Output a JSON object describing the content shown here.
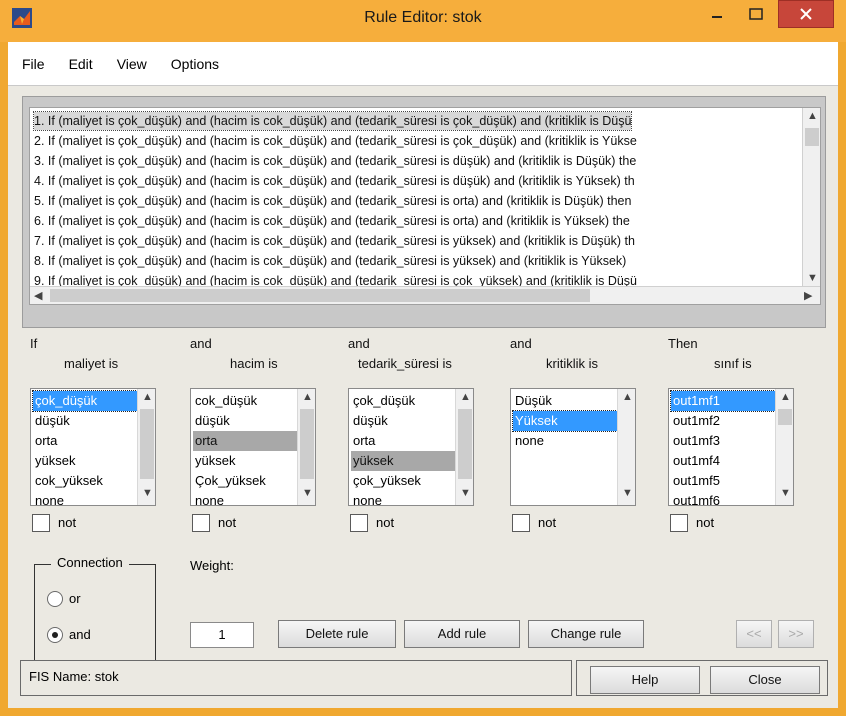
{
  "window": {
    "title": "Rule Editor: stok"
  },
  "menu": [
    "File",
    "Edit",
    "View",
    "Options"
  ],
  "rules": [
    "1. If (maliyet is çok_düşük) and (hacim is cok_düşük) and (tedarik_süresi is çok_düşük) and (kritiklik is Düşü",
    "2. If (maliyet is çok_düşük) and (hacim is cok_düşük) and (tedarik_süresi is çok_düşük) and (kritiklik is Yükse",
    "3. If (maliyet is çok_düşük) and (hacim is cok_düşük) and (tedarik_süresi is düşük) and (kritiklik is Düşük) the",
    "4. If (maliyet is çok_düşük) and (hacim is cok_düşük) and (tedarik_süresi is düşük) and (kritiklik is Yüksek) th",
    "5. If (maliyet is çok_düşük) and (hacim is cok_düşük) and (tedarik_süresi is orta) and (kritiklik is Düşük) then",
    "6. If (maliyet is çok_düşük) and (hacim is cok_düşük) and (tedarik_süresi is orta) and (kritiklik is Yüksek) the",
    "7. If (maliyet is çok_düşük) and (hacim is cok_düşük) and (tedarik_süresi is yüksek) and (kritiklik is Düşük) th",
    "8. If (maliyet is çok_düşük) and (hacim is cok_düşük) and (tedarik_süresi is yüksek) and (kritiklik is Yüksek)",
    "9. If (maliyet is çok_düşük) and (hacim is cok_düşük) and (tedarik_süresi is çok_yüksek) and (kritiklik is Düşü"
  ],
  "columns": [
    {
      "prefix": "If",
      "label": "maliyet is",
      "items": [
        "çok_düşük",
        "düşük",
        "orta",
        "yüksek",
        "cok_yüksek",
        "none"
      ],
      "selected": 0,
      "focused": true
    },
    {
      "prefix": "and",
      "label": "hacim is",
      "items": [
        "cok_düşük",
        "düşük",
        "orta",
        "yüksek",
        "Çok_yüksek",
        "none"
      ],
      "selected": 2,
      "focused": false
    },
    {
      "prefix": "and",
      "label": "tedarik_süresi is",
      "items": [
        "çok_düşük",
        "düşük",
        "orta",
        "yüksek",
        "çok_yüksek",
        "none"
      ],
      "selected": 3,
      "focused": false
    },
    {
      "prefix": "and",
      "label": "kritiklik is",
      "items": [
        "Düşük",
        "Yüksek",
        "none"
      ],
      "selected": 1,
      "focused": true
    },
    {
      "prefix": "Then",
      "label": "sınıf is",
      "items": [
        "out1mf1",
        "out1mf2",
        "out1mf3",
        "out1mf4",
        "out1mf5",
        "out1mf6"
      ],
      "selected": 0,
      "focused": true
    }
  ],
  "not_label": "not",
  "connection": {
    "title": "Connection",
    "options": [
      "or",
      "and"
    ],
    "selected": "and"
  },
  "weight": {
    "label": "Weight:",
    "value": "1"
  },
  "buttons": {
    "delete": "Delete rule",
    "add": "Add rule",
    "change": "Change rule",
    "prev": "<<",
    "next": ">>",
    "help": "Help",
    "close": "Close"
  },
  "status": "FIS Name: stok",
  "colors": {
    "titlebar": "#f6ae3c",
    "selection": "#3399ff",
    "close_button": "#c7463a"
  }
}
